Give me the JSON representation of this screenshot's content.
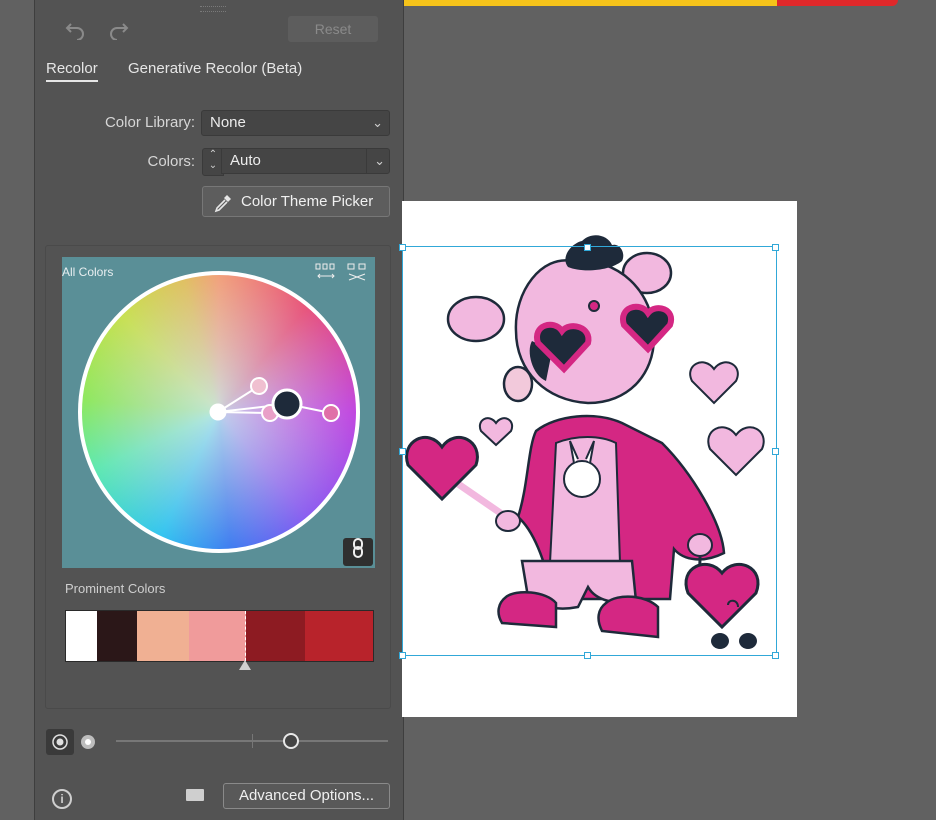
{
  "toolbar": {
    "undo_icon": "undo-icon",
    "redo_icon": "redo-icon",
    "reset_label": "Reset"
  },
  "tabs": [
    {
      "label": "Recolor",
      "active": true
    },
    {
      "label": "Generative Recolor (Beta)",
      "active": false
    }
  ],
  "color_library": {
    "label": "Color Library:",
    "value": "None"
  },
  "colors": {
    "label": "Colors:",
    "value": "Auto"
  },
  "picker_button": {
    "label": "Color Theme Picker",
    "icon": "eyedropper-icon"
  },
  "wheel": {
    "label": "All Colors",
    "view_icons": [
      "linked-harmony-icon",
      "unlink-harmony-icon"
    ],
    "link_icon": "link-icon",
    "markers": [
      {
        "color": "#ffffff"
      },
      {
        "color": "#f0c0d0"
      },
      {
        "color": "#e9a0c8"
      },
      {
        "color": "#1e2a3a",
        "base": true
      },
      {
        "color": "#e070a8"
      }
    ]
  },
  "prominent": {
    "label": "Prominent Colors",
    "swatches": [
      {
        "color": "#ffffff",
        "share": 0.1
      },
      {
        "color": "#2b1718",
        "share": 0.13
      },
      {
        "color": "#f0b093",
        "share": 0.17
      },
      {
        "color": "#f09b9b",
        "share": 0.19
      },
      {
        "color": "#8d1b22",
        "share": 0.19
      },
      {
        "color": "#b8232b",
        "share": 0.22
      }
    ]
  },
  "brightness_slider": {
    "value": 0.64
  },
  "footer": {
    "info_icon": "info-icon",
    "folder_icon": "folder-icon",
    "advanced_label": "Advanced Options..."
  },
  "canvas": {
    "artwork": "cartoon character in pink suit with heart sunglasses, lollipop and heart companion"
  }
}
